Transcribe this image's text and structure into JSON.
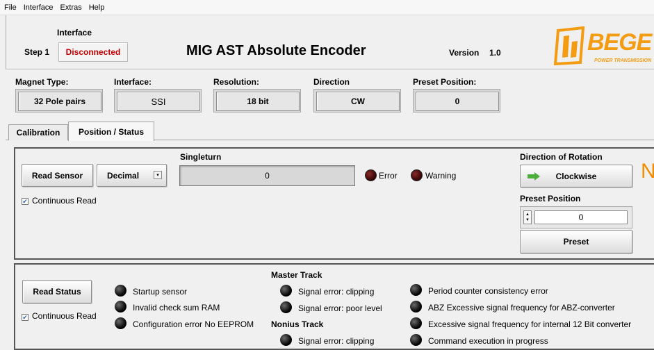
{
  "menu": [
    "File",
    "Interface",
    "Extras",
    "Help"
  ],
  "header": {
    "interface_label": "Interface",
    "step_label": "Step 1",
    "status": "Disconnected",
    "title": "MIG AST Absolute Encoder",
    "version_label": "Version",
    "version_value": "1.0",
    "logo_text": "BEGE",
    "logo_subtext": "POWER TRANSMISSION"
  },
  "config": {
    "magnet_type_label": "Magnet Type:",
    "magnet_type": "32 Pole pairs",
    "interface_label": "Interface:",
    "interface": "SSI",
    "resolution_label": "Resolution:",
    "resolution": "18 bit",
    "direction_label": "Direction",
    "direction": "CW",
    "preset_label": "Preset Position:",
    "preset": "0"
  },
  "tabs": [
    "Calibration",
    "Position / Status"
  ],
  "sensor": {
    "read_button": "Read Sensor",
    "format": "Decimal",
    "singleturn_label": "Singleturn",
    "singleturn_value": "0",
    "error_label": "Error",
    "warning_label": "Warning",
    "continuous_label": "Continuous Read",
    "direction_label": "Direction of Rotation",
    "direction_button": "Clockwise",
    "preset_label": "Preset Position",
    "preset_value": "0",
    "preset_button": "Preset",
    "overflow_letter": "N"
  },
  "status": {
    "read_button": "Read Status",
    "continuous_label": "Continuous Read",
    "col1": [
      "Startup sensor",
      "Invalid check sum RAM",
      "Configuration error No EEPROM"
    ],
    "master_label": "Master Track",
    "master_items": [
      "Signal error: clipping",
      "Signal error: poor level"
    ],
    "nonius_label": "Nonius Track",
    "nonius_items": [
      "Signal error: clipping"
    ],
    "col3": [
      "Period counter consistency error",
      "ABZ Excessive signal frequency for ABZ-converter",
      "Excessive signal frequency for internal 12 Bit converter",
      "Command execution in progress"
    ]
  },
  "colors": {
    "status_red": "#c00000",
    "arrow_green": "#4caf3c",
    "logo_orange": "#f39c12",
    "accent_orange": "#f28c00"
  }
}
